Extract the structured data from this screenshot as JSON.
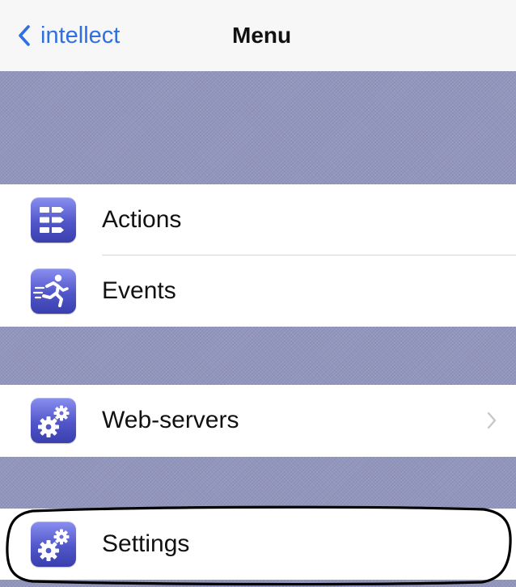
{
  "navbar": {
    "back_label": "intellect",
    "title": "Menu"
  },
  "menu": {
    "actions_label": "Actions",
    "events_label": "Events",
    "web_servers_label": "Web-servers",
    "settings_label": "Settings"
  },
  "icons": {
    "back": "chevron-left-icon",
    "actions": "actions-icon",
    "events": "running-man-icon",
    "web_servers": "gears-icon",
    "settings": "gears-icon",
    "disclosure": "chevron-right-icon"
  },
  "colors": {
    "accent": "#2f6fe0",
    "separator": "#9396bd",
    "icon_tile": "#5156c9",
    "highlight": "#000000"
  }
}
